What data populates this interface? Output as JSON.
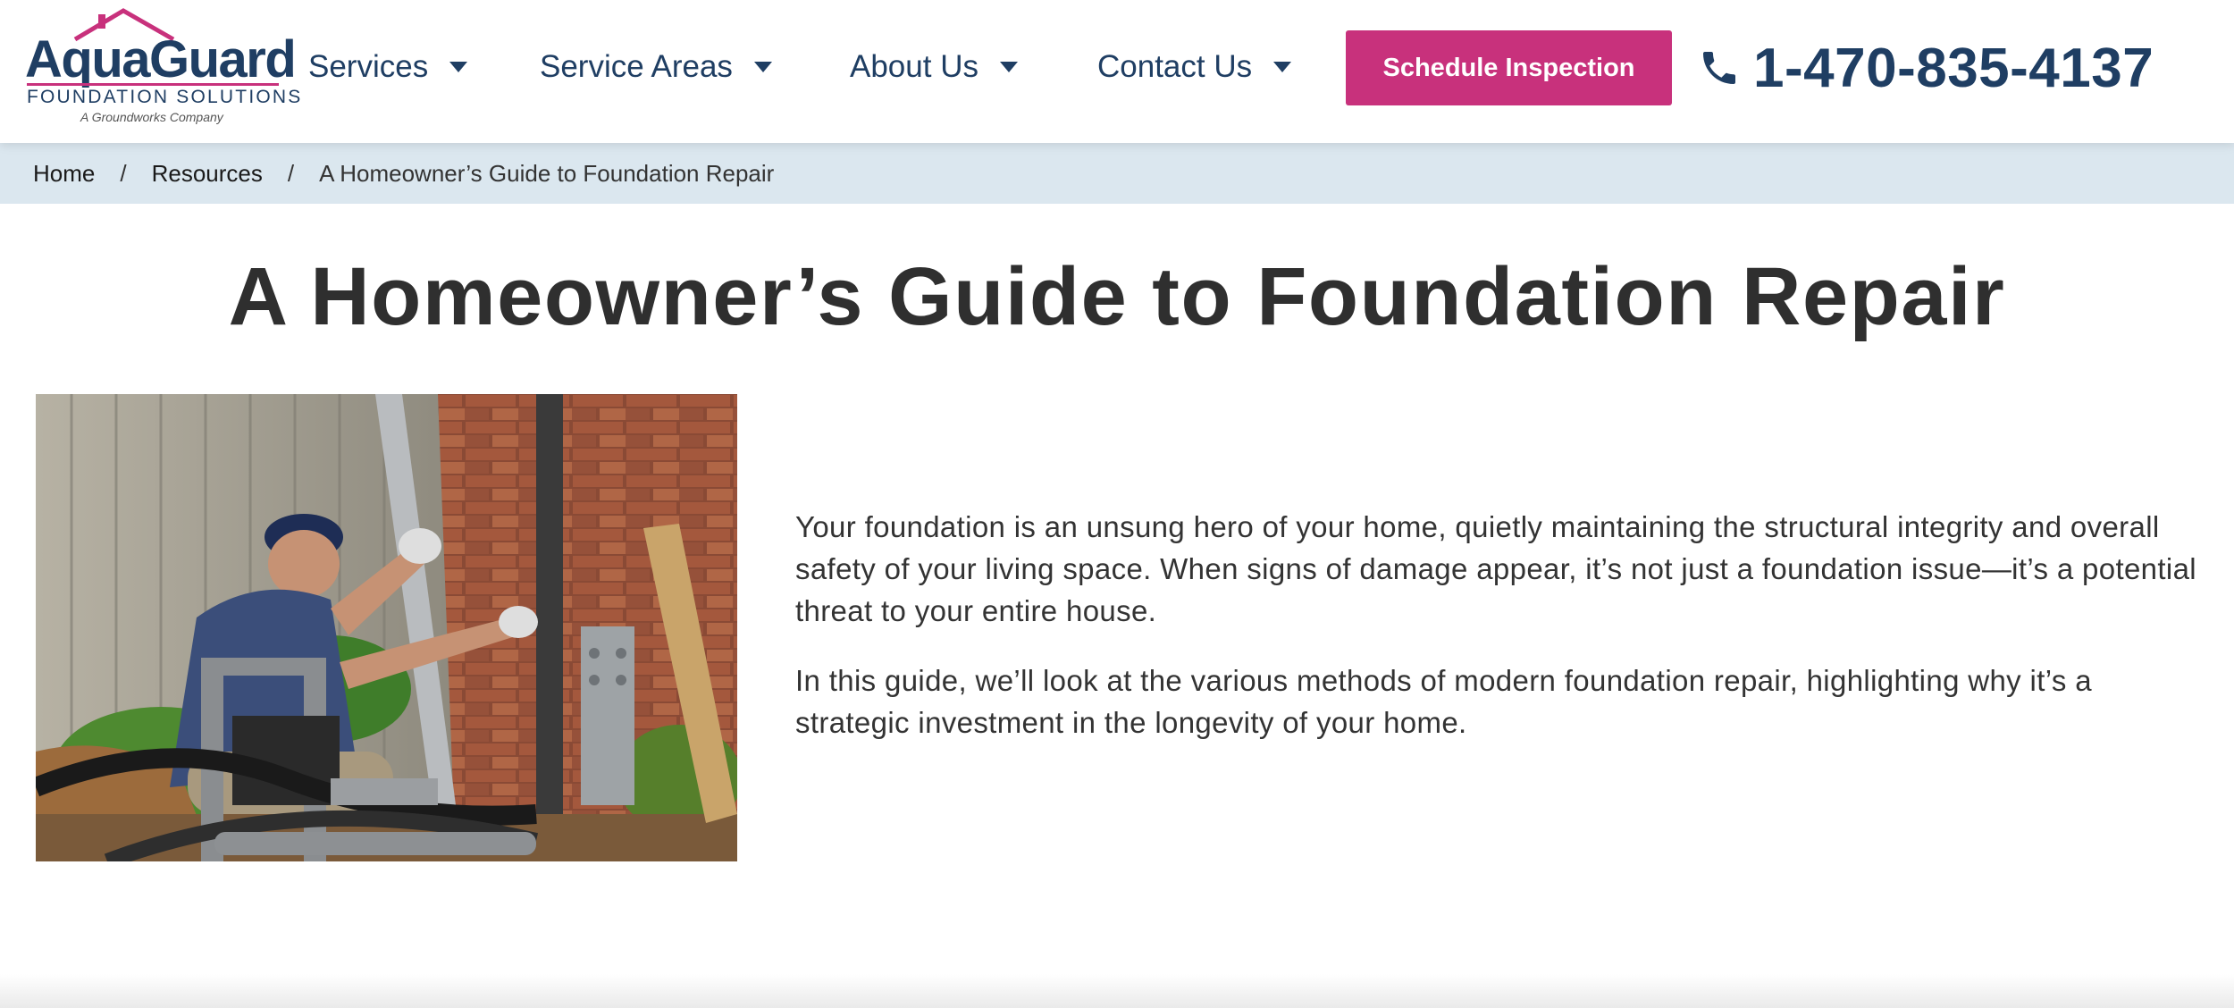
{
  "brand": {
    "name_part1": "Aqua",
    "name_part2": "Guard",
    "subtitle": "FOUNDATION SOLUTIONS",
    "tagline": "A Groundworks Company",
    "colors": {
      "navy": "#1f3e63",
      "magenta": "#c8317c"
    }
  },
  "nav": {
    "items": [
      {
        "label": "Services",
        "icon": "chevron-down-icon"
      },
      {
        "label": "Service Areas",
        "icon": "chevron-down-icon"
      },
      {
        "label": "About Us",
        "icon": "chevron-down-icon"
      },
      {
        "label": "Contact Us",
        "icon": "chevron-down-icon"
      }
    ],
    "cta_label": "Schedule Inspection",
    "phone": {
      "icon": "phone-icon",
      "number": "1-470-835-4137"
    }
  },
  "breadcrumb": {
    "items": [
      "Home",
      "Resources",
      "A Homeowner’s Guide to Foundation Repair"
    ],
    "separator": "/",
    "background": "#dbe7ef"
  },
  "article": {
    "title": "A Homeowner’s Guide to Foundation Repair",
    "hero_image": "worker-installing-foundation-pier-photo",
    "paragraphs": [
      "Your foundation is an unsung hero of your home, quietly maintaining the structural integrity and overall safety of your living space. When signs of damage appear, it’s not just a foundation issue—it’s a potential threat to your entire house.",
      "In this guide, we’ll look at the various methods of modern foundation repair, highlighting why it’s a strategic investment in the longevity of your home."
    ]
  }
}
